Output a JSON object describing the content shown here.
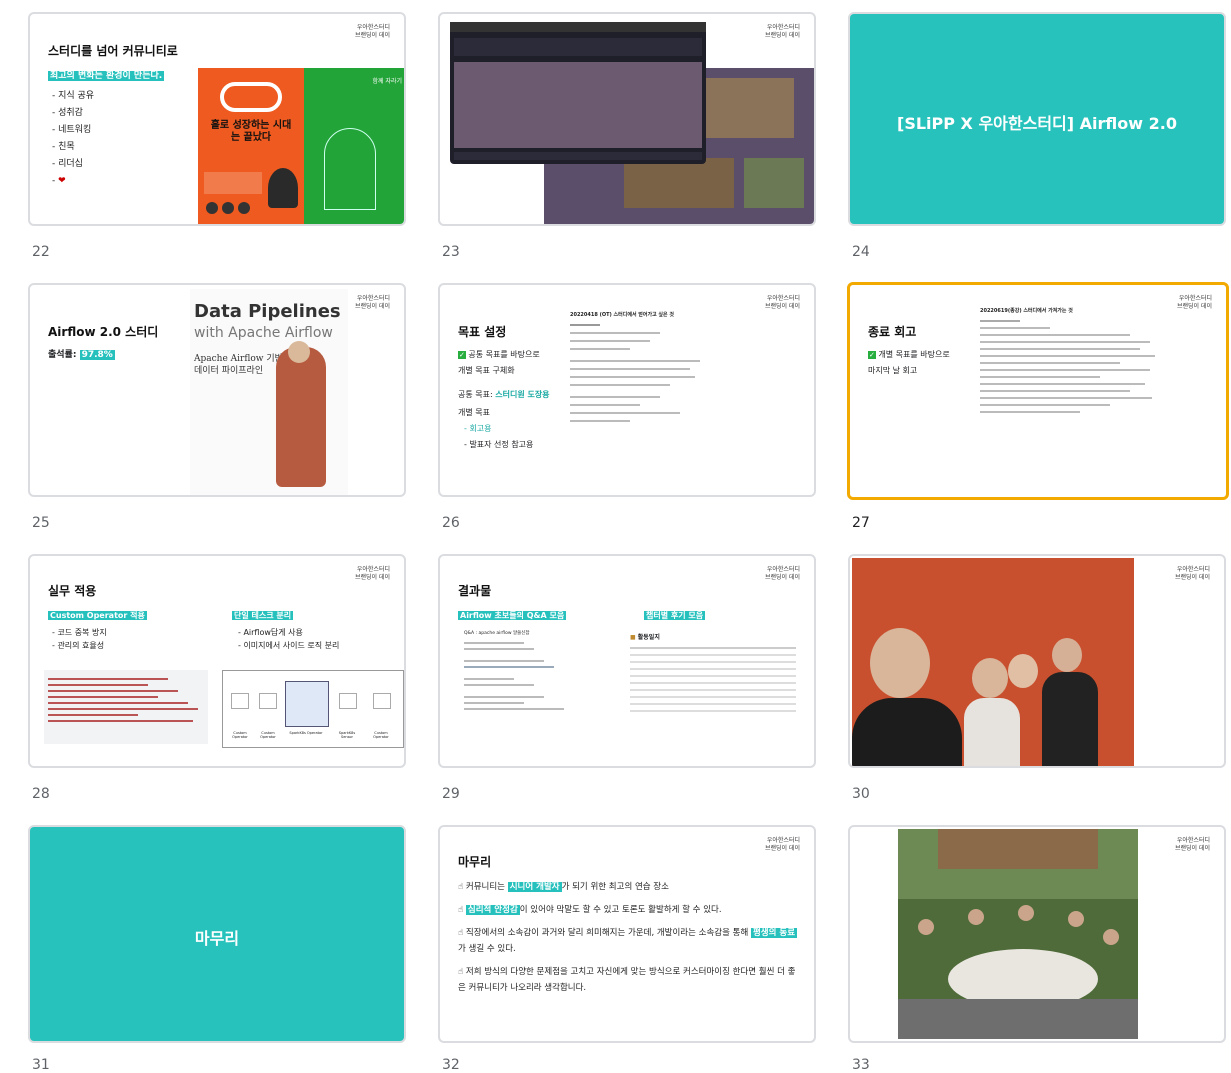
{
  "brand": {
    "line1": "우아한스터디",
    "line2": "브랜딩이 데이"
  },
  "slides": [
    {
      "num": "22",
      "title": "스터디를 넘어 커뮤니티로",
      "highlight": "최고의 변화는 환경이 만든다.",
      "bullets": [
        "지식 공유",
        "성취감",
        "네트워킹",
        "친목",
        "리더십"
      ],
      "book": {
        "title_main": "홀로 성장하는 시대는 끝났다",
        "right_title": "함께 자라기"
      }
    },
    {
      "num": "23"
    },
    {
      "num": "24",
      "title": "[SLiPP X 우아한스터디] Airflow 2.0"
    },
    {
      "num": "25",
      "title": "Airflow 2.0 스터디",
      "attendance_label": "출석률:",
      "attendance_value": "97.8%",
      "book": {
        "line1": "Data Pipelines",
        "line2": "with Apache Airflow",
        "kr1": "Apache Airflow 기반의",
        "kr2": "데이터 파이프라인"
      }
    },
    {
      "num": "26",
      "title": "목표 설정",
      "check1": "공통 목표를 바탕으로",
      "check2": "개별 목표 구체화",
      "common_label": "공통 목표:",
      "common_value": "스터디원 도장용",
      "individual_label": "개별 목표",
      "ind_items": [
        "회고용",
        "발표자 선정 참고용"
      ],
      "doc_title": "20220418 (OT) 스터디에서 얻어가고 싶은 것"
    },
    {
      "num": "27",
      "title": "종료 회고",
      "check1": "개별 목표를 바탕으로",
      "check2": "마지막 날 회고",
      "doc_title": "20220619(종강) 스터디에서 가져가는 것"
    },
    {
      "num": "28",
      "title": "실무 적용",
      "left_head": "Custom Operator 적용",
      "left_items": [
        "코드 중복 방지",
        "관리의 효율성"
      ],
      "right_head": "단일 테스크 분리",
      "right_items": [
        "Airflow답게 사용",
        "이미지에서 사이드 로직 분리"
      ],
      "diagram_labels": [
        "Custom Operator",
        "Custom Operator",
        "SparkK8s Operator",
        "SparkK8s Sensor",
        "Custom Operator"
      ]
    },
    {
      "num": "29",
      "title": "결과물",
      "left_head": "Airflow 초보들의 Q&A 모음",
      "right_head": "챕터별 후기 모음",
      "doc_left_title": "Q&A : apache airflow 알쓸신잡",
      "doc_right_title": "활동일지"
    },
    {
      "num": "30"
    },
    {
      "num": "31",
      "title": "마무리"
    },
    {
      "num": "32",
      "title": "마무리",
      "lines": [
        {
          "pre": "커뮤니티는 ",
          "hl": "시니어 개발자",
          "post": "가 되기 위한 최고의 연습 장소"
        },
        {
          "pre": "",
          "hl": "심리적 안정감",
          "post": "이 있어야 막말도 할 수 있고 토론도 활발하게 할 수 있다."
        },
        {
          "pre": "직장에서의 소속감이 과거와 달리 희미해지는 가운데, 개발이라는 소속감을 통해 ",
          "hl": "평생의 동료",
          "post": "가 생길 수 있다."
        },
        {
          "pre": "저희 방식의 다양한 문제점을 고치고 자신에게 맞는 방식으로 커스터마이징 한다면 훨씬 더 좋은 커뮤니티가 나오리라 생각합니다.",
          "hl": "",
          "post": ""
        }
      ]
    },
    {
      "num": "33"
    }
  ],
  "colors": {
    "accent": "#28c2bc",
    "selected_border": "#f2a900"
  }
}
